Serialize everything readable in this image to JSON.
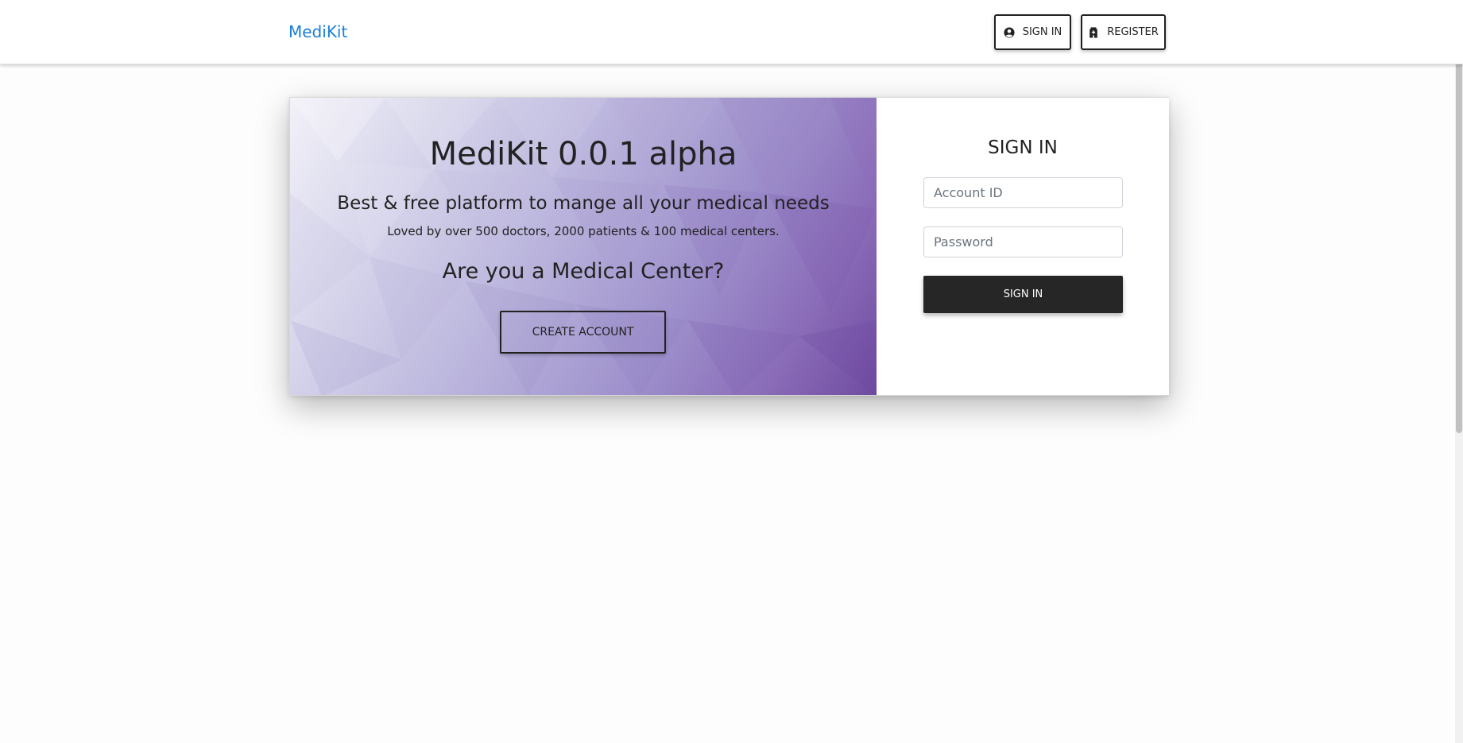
{
  "navbar": {
    "brand": "MediKit",
    "signin_label": "SIGN IN",
    "register_label": "REGISTER",
    "signin_icon": "user-circle-icon",
    "register_icon": "hospital-icon"
  },
  "hero": {
    "title": "MediKit 0.0.1 alpha",
    "tagline": "Best & free platform to mange all your medical needs",
    "subline": "Loved by over 500 doctors, 2000 patients & 100 medical centers.",
    "question": "Are you a Medical Center?",
    "create_label": "CREATE ACCOUNT"
  },
  "signin_form": {
    "title": "SIGN IN",
    "account_placeholder": "Account ID",
    "password_placeholder": "Password",
    "submit_label": "SIGN IN"
  },
  "colors": {
    "brand": "#1a7fd8",
    "dark_button": "#262626",
    "hero_gradient_end": "#6f4ba0"
  }
}
